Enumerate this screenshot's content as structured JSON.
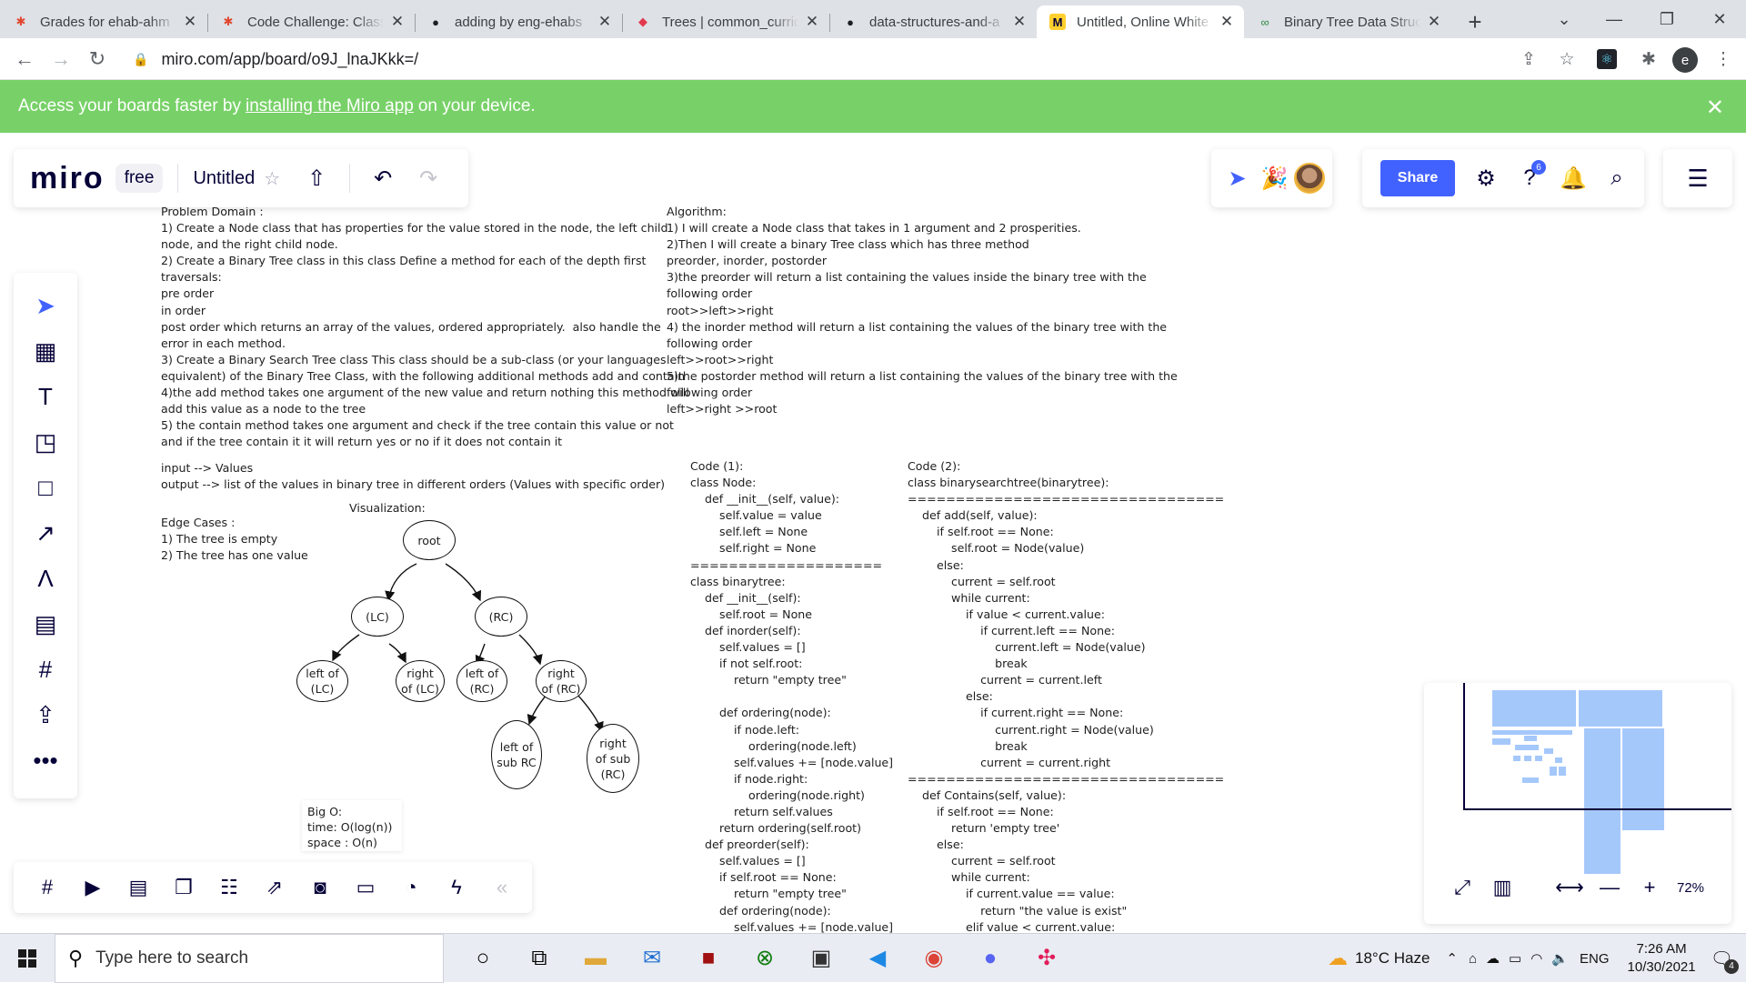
{
  "browser": {
    "tabs": [
      {
        "title": "Grades for ehab-ahm",
        "icon": "canvas-icon",
        "color": "#e0472e"
      },
      {
        "title": "Code Challenge: Class",
        "icon": "canvas-icon",
        "color": "#e0472e"
      },
      {
        "title": "adding by eng-ehabs",
        "icon": "github-icon",
        "color": "#1b1f23"
      },
      {
        "title": "Trees | common_curric",
        "icon": "code-icon",
        "color": "#e2384d"
      },
      {
        "title": "data-structures-and-a",
        "icon": "github-icon",
        "color": "#1b1f23"
      },
      {
        "title": "Untitled, Online White",
        "icon": "miro-icon",
        "color": "#ffd02f",
        "active": true
      },
      {
        "title": "Binary Tree Data Struc",
        "icon": "gfg-icon",
        "color": "#2f8d46"
      }
    ],
    "url": "miro.com/app/board/o9J_lnaJKkk=/",
    "profile_letter": "e"
  },
  "banner": {
    "prefix": "Access your boards faster by",
    "link": "installing the Miro app",
    "suffix": "on your device."
  },
  "miro": {
    "logo": "miro",
    "plan": "free",
    "board_name": "Untitled",
    "share_label": "Share",
    "notification_count": "6",
    "zoom": "72%"
  },
  "content": {
    "problem_domain": [
      "Problem Domain :",
      "1) Create a Node class that has properties for the value stored in the node, the left child",
      "node, and the right child node.",
      "2) Create a Binary Tree class in this class Define a method for each of the depth first",
      "traversals:",
      "pre order",
      "in order",
      "post order which returns an array of the values, ordered appropriately.  also handle the",
      "error in each method.",
      "3) Create a Binary Search Tree class This class should be a sub-class (or your languages",
      "equivalent) of the Binary Tree Class, with the following additional methods add and contain",
      "4)the add method takes one argument of the new value and return nothing this method will",
      "add this value as a node to the tree",
      "5) the contain method takes one argument and check if the tree contain this value or not",
      "and if the tree contain it it will return yes or no if it does not contain it"
    ],
    "io": [
      "input --> Values",
      "output --> list of the values in binary tree in different orders (Values with specific order)"
    ],
    "visualization_label": "Visualization:",
    "edge_cases": [
      "Edge Cases :",
      "1) The tree is empty",
      "2) The tree has one value"
    ],
    "algorithm": [
      "Algorithm:",
      "1) I will create a Node class that takes in 1 argument and 2 prosperities.",
      "2)Then I will create a binary Tree class which has three method",
      "preorder, inorder, postorder",
      "3)the preorder will return a list containing the values inside the binary tree with the",
      "following order",
      "root>>left>>right",
      "4) the inorder method will return a list containing the values of the binary tree with the",
      "following order",
      "left>>root>>right",
      "5)the postorder method will return a list containing the values of the binary tree with the",
      "following order",
      "left>>right >>root"
    ],
    "code1": [
      "Code (1):",
      "class Node:",
      "    def __init__(self, value):",
      "        self.value = value",
      "        self.left = None",
      "        self.right = None",
      "====================",
      "class binarytree:",
      "    def __init__(self):",
      "        self.root = None",
      "    def inorder(self):",
      "        self.values = []",
      "        if not self.root:",
      "            return \"empty tree\"",
      "",
      "        def ordering(node):",
      "            if node.left:",
      "                ordering(node.left)",
      "            self.values += [node.value]",
      "            if node.right:",
      "                ordering(node.right)",
      "            return self.values",
      "        return ordering(self.root)",
      "    def preorder(self):",
      "        self.values = []",
      "        if self.root == None:",
      "            return \"empty tree\"",
      "        def ordering(node):",
      "            self.values += [node.value]"
    ],
    "code2": [
      "Code (2):",
      "class binarysearchtree(binarytree):",
      "=================================",
      "    def add(self, value):",
      "        if self.root == None:",
      "            self.root = Node(value)",
      "        else:",
      "            current = self.root",
      "            while current:",
      "                if value < current.value:",
      "                    if current.left == None:",
      "                        current.left = Node(value)",
      "                        break",
      "                    current = current.left",
      "                else:",
      "                    if current.right == None:",
      "                        current.right = Node(value)",
      "                        break",
      "                    current = current.right",
      "=================================",
      "    def Contains(self, value):",
      "        if self.root == None:",
      "            return 'empty tree'",
      "        else:",
      "            current = self.root",
      "            while current:",
      "                if current.value == value:",
      "                    return \"the value is exist\"",
      "                elif value < current.value:"
    ],
    "tree_nodes": {
      "root": "root",
      "lc": "(LC)",
      "rc": "(RC)",
      "left_of_lc": "left of\n(LC)",
      "right_of_lc": "right\nof (LC)",
      "left_of_rc": "left of\n(RC)",
      "right_of_rc": "right\nof (RC)",
      "left_of_sub_rc": "left of\nsub RC",
      "right_of_sub_rc": "right\nof sub\n(RC)"
    },
    "big_o": [
      "Big O:",
      "time:  O(log(n))",
      "space : O(n)"
    ]
  },
  "taskbar": {
    "search_placeholder": "Type here to search",
    "weather": "18°C  Haze",
    "language": "ENG",
    "time": "7:26 AM",
    "date": "10/30/2021",
    "notification_count": "4"
  }
}
